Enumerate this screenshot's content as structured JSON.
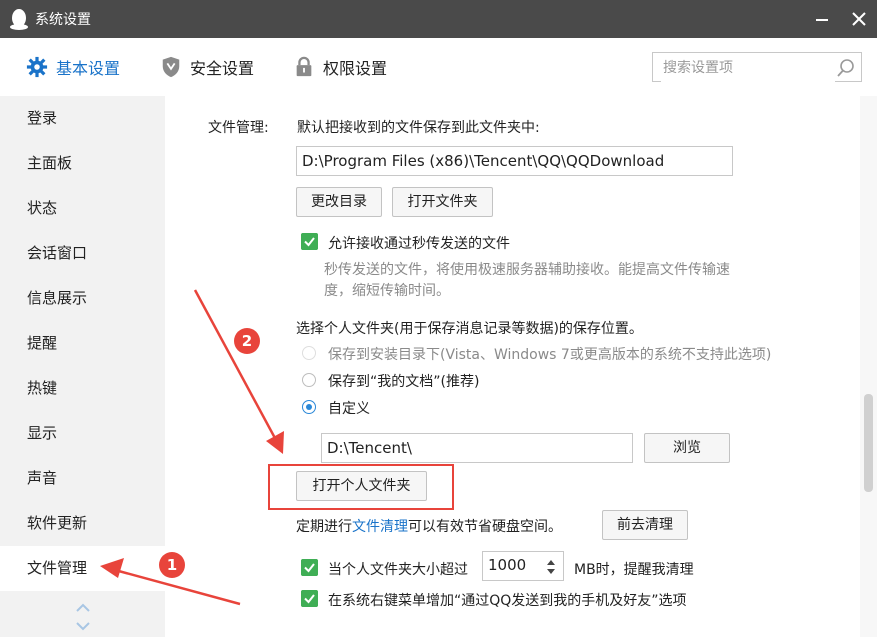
{
  "window": {
    "title": "系统设置"
  },
  "tabs": [
    {
      "label": "基本设置",
      "icon": "gear-icon",
      "active": true
    },
    {
      "label": "安全设置",
      "icon": "shield-icon",
      "active": false
    },
    {
      "label": "权限设置",
      "icon": "lock-icon",
      "active": false
    }
  ],
  "search": {
    "placeholder": "搜索设置项",
    "value": ""
  },
  "sidebar": {
    "items": [
      {
        "label": "登录"
      },
      {
        "label": "主面板"
      },
      {
        "label": "状态"
      },
      {
        "label": "会话窗口"
      },
      {
        "label": "信息展示"
      },
      {
        "label": "提醒"
      },
      {
        "label": "热键"
      },
      {
        "label": "显示"
      },
      {
        "label": "声音"
      },
      {
        "label": "软件更新"
      },
      {
        "label": "文件管理",
        "active": true
      }
    ]
  },
  "file_mgmt": {
    "section_label": "文件管理:",
    "default_save_text": "默认把接收到的文件保存到此文件夹中:",
    "download_path": "D:\\Program Files (x86)\\Tencent\\QQ\\QQDownload",
    "change_dir_label": "更改目录",
    "open_folder_label": "打开文件夹",
    "allow_flash_label": "允许接收通过秒传发送的文件",
    "allow_flash_checked": true,
    "flash_desc_line1": "秒传发送的文件，将使用极速服务器辅助接收。能提高文件传输速",
    "flash_desc_line2": "度，缩短传输时间。",
    "personal_folder_title": "选择个人文件夹(用于保存消息记录等数据)的保存位置。",
    "radio_install_label": "保存到安装目录下(Vista、Windows 7或更高版本的系统不支持此选项)",
    "radio_mydocs_label": "保存到“我的文档”(推荐)",
    "radio_custom_label": "自定义",
    "custom_path": "D:\\Tencent\\",
    "browse_label": "浏览",
    "open_personal_label": "打开个人文件夹",
    "cleanup_prefix": "定期进行",
    "cleanup_link": "文件清理",
    "cleanup_suffix": "可以有效节省硬盘空间。",
    "cleanup_button_label": "前去清理",
    "size_warn_prefix": "当个人文件夹大小超过",
    "size_limit": "1000",
    "size_warn_suffix": "MB时，提醒我清理",
    "size_warn_checked": true,
    "context_menu_label": "在系统右键菜单增加“通过QQ发送到我的手机及好友”选项",
    "context_menu_checked": true
  },
  "annotations": [
    {
      "number": "1"
    },
    {
      "number": "2"
    }
  ],
  "colors": {
    "accent": "#1a73c9",
    "titlebar": "#4a4a4a",
    "checkbox": "#3fae55",
    "annotation": "#e8443b"
  }
}
